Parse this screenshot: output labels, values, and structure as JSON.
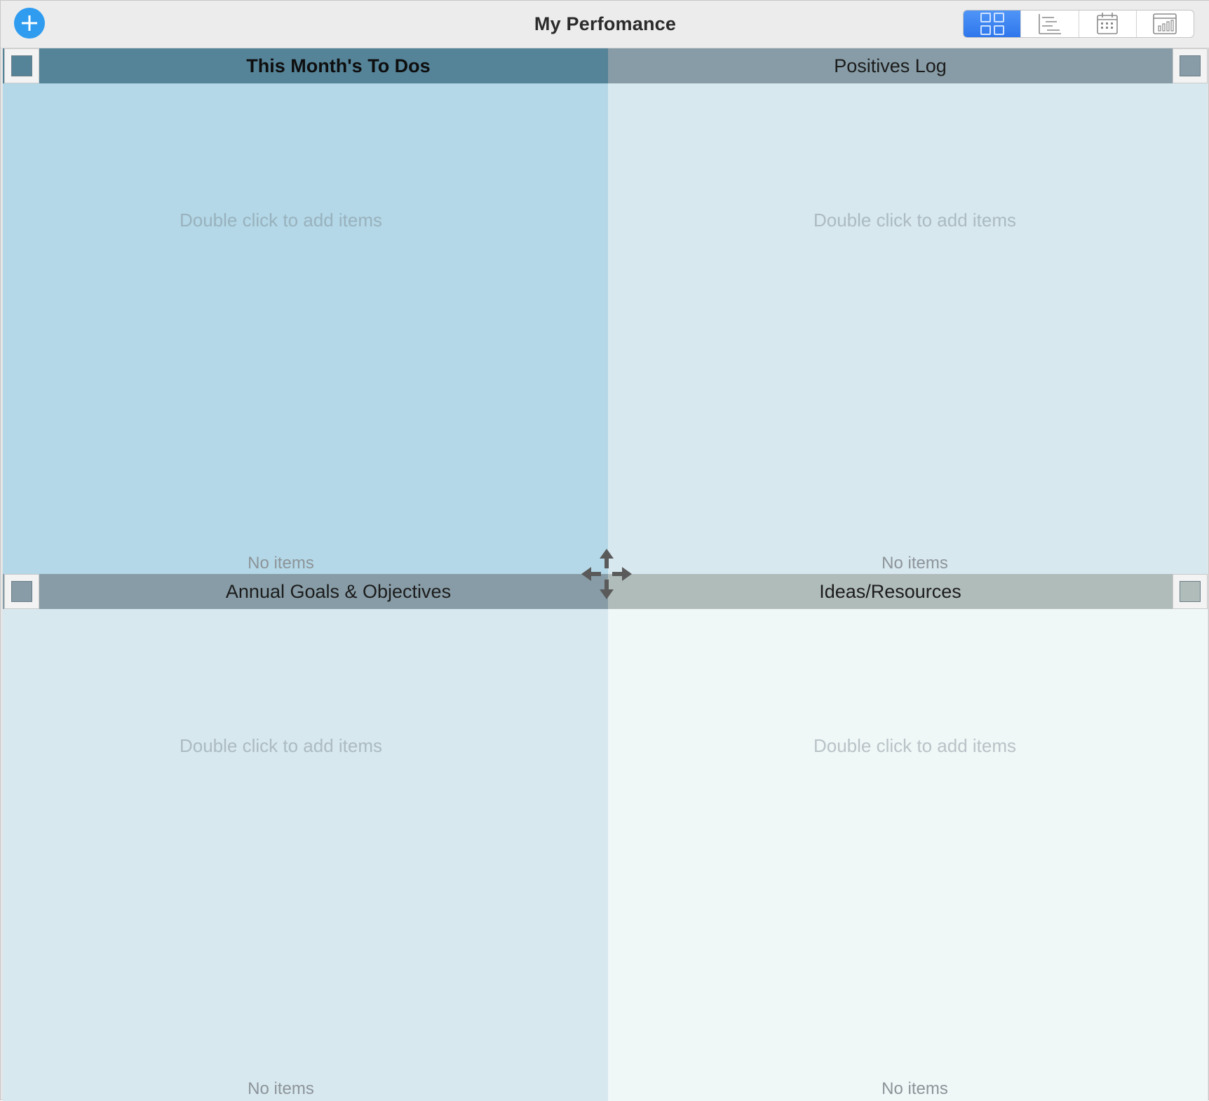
{
  "window": {
    "title": "My Perfomance"
  },
  "toolbar": {
    "add_icon": "plus-circle-icon",
    "accent_color": "#2f9cf0",
    "view_switcher": [
      {
        "icon": "quadrant-grid-icon",
        "active": true
      },
      {
        "icon": "outline-list-icon",
        "active": false
      },
      {
        "icon": "calendar-icon",
        "active": false
      },
      {
        "icon": "chart-report-icon",
        "active": false
      }
    ]
  },
  "quadrants": [
    {
      "title": "This Month's To Dos",
      "hint": "Double click to add items",
      "count": "No items",
      "header_color": "#558398",
      "body_color": "#b4d8e7",
      "selected": true
    },
    {
      "title": "Positives Log",
      "hint": "Double click to add items",
      "count": "No items",
      "header_color": "#879ca6",
      "body_color": "#d8e8ef",
      "selected": false
    },
    {
      "title": "Annual Goals & Objectives",
      "hint": "Double click to add items",
      "count": "No items",
      "header_color": "#879ca6",
      "body_color": "#d8e8ef",
      "selected": false
    },
    {
      "title": "Ideas/Resources",
      "hint": "Double click to add items",
      "count": "No items",
      "header_color": "#b0bcba",
      "body_color": "#eff7f7",
      "selected": false
    }
  ],
  "center_handle_icon": "move-arrows-icon"
}
